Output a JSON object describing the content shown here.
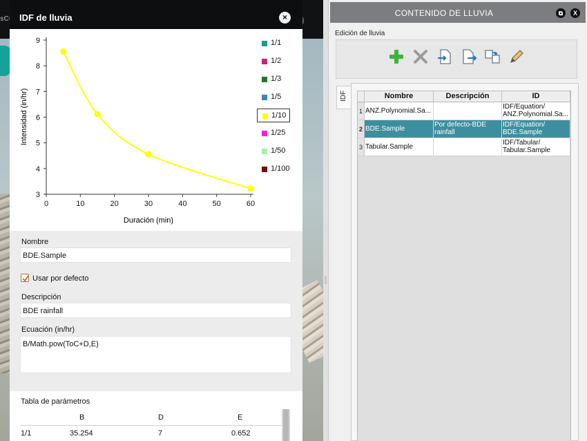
{
  "background_app": {
    "brand_fragment": "sCOMPOSER",
    "help_glyph": "?"
  },
  "idf_dialog": {
    "title": "IDF de lluvia",
    "close_glyph": "×",
    "legend": [
      {
        "label": "1/1",
        "color": "#1a9a91"
      },
      {
        "label": "1/2",
        "color": "#c8227a"
      },
      {
        "label": "1/3",
        "color": "#1e7a26"
      },
      {
        "label": "1/5",
        "color": "#3f86bf"
      },
      {
        "label": "1/10",
        "color": "#ffff00",
        "selected": true
      },
      {
        "label": "1/25",
        "color": "#ff1ae0"
      },
      {
        "label": "1/50",
        "color": "#9df5a2"
      },
      {
        "label": "1/100",
        "color": "#7a0c0c"
      }
    ],
    "form": {
      "name_label": "Nombre",
      "name_value": "BDE.Sample",
      "default_checked": true,
      "default_label": "Usar por defecto",
      "description_label": "Descripción",
      "description_value": "BDE rainfall",
      "equation_label": "Ecuación (in/hr)",
      "equation_value": "B/Math.pow(ToC+D,E)"
    },
    "params": {
      "title": "Tabla de parámetros",
      "headers": [
        "B",
        "D",
        "E"
      ],
      "rows": [
        {
          "label": "1/1",
          "B": "35.254",
          "D": "7",
          "E": "0.652"
        }
      ]
    }
  },
  "chart_data": {
    "type": "line",
    "title": "",
    "xlabel": "Duración (min)",
    "ylabel": "Intensidad (in/hr)",
    "xlim": [
      0,
      60
    ],
    "ylim": [
      3,
      9
    ],
    "xticks": [
      0,
      10,
      20,
      30,
      40,
      50,
      60
    ],
    "yticks": [
      3,
      4,
      5,
      6,
      7,
      8,
      9
    ],
    "grid": false,
    "legend_position": "right",
    "series": [
      {
        "name": "1/10",
        "color": "#ffff00",
        "x": [
          5,
          15,
          30,
          60
        ],
        "y": [
          8.56,
          6.12,
          4.56,
          3.22
        ]
      }
    ]
  },
  "rain_panel": {
    "title": "CONTENIDO DE LLUVIA",
    "restore_glyph": "⧉",
    "close_glyph": "X",
    "subtitle": "Edición de lluvia",
    "toolbar_icons": [
      "add-icon",
      "delete-icon",
      "import-icon",
      "export-icon",
      "duplicate-icon",
      "edit-icon"
    ],
    "tab_label": "IDF",
    "columns": [
      "Nombre",
      "Descripción",
      "ID"
    ],
    "rows": [
      {
        "num": "1",
        "name": "ANZ.Polynomial.Sa...",
        "description": "",
        "id": "IDF/Equation/ ANZ.Polynomial.Sa..."
      },
      {
        "num": "2",
        "name": "BDE.Sample",
        "description": "Por defecto-BDE rainfall",
        "id": "IDF/Equation/ BDE.Sample",
        "selected": true
      },
      {
        "num": "3",
        "name": "Tabular.Sample",
        "description": "",
        "id": "IDF/Tabular/ Tabular.Sample"
      }
    ]
  }
}
